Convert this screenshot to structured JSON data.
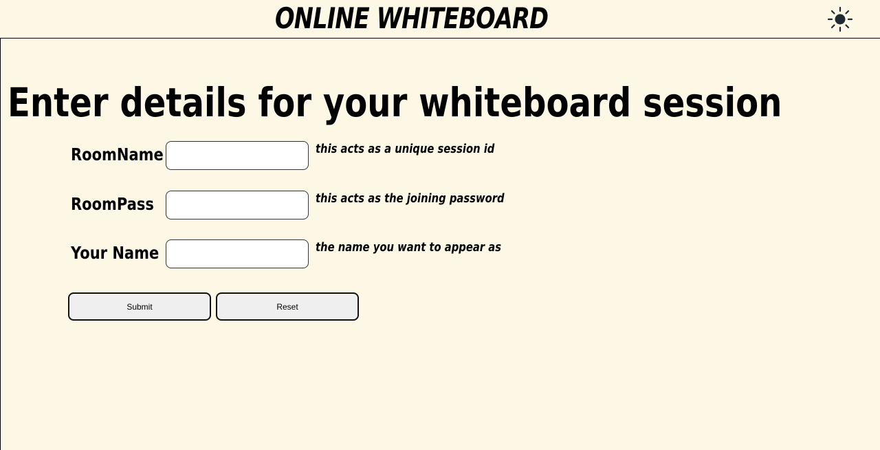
{
  "header": {
    "brand": "ONLINE WHITEBOARD",
    "theme_toggle_icon": "sun-icon"
  },
  "main": {
    "title": "Enter details for your whiteboard session",
    "fields": [
      {
        "label": "RoomName",
        "value": "",
        "hint": "this acts as a unique session id"
      },
      {
        "label": "RoomPass",
        "value": "",
        "hint": "this acts as the joining password"
      },
      {
        "label": "Your Name",
        "value": "",
        "hint": "the name you want to appear as"
      }
    ],
    "buttons": {
      "submit": "Submit",
      "reset": "Reset"
    }
  },
  "colors": {
    "background": "#fdf8e6",
    "input_background": "#ffffff",
    "button_background": "#efefef",
    "text": "#000000"
  }
}
